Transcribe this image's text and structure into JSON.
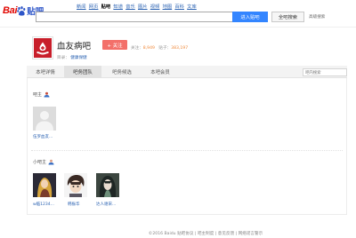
{
  "header": {
    "logo_left": "Bai",
    "logo_right": "贴吧",
    "nav": [
      "新闻",
      "网页",
      "贴吧",
      "知道",
      "音乐",
      "图片",
      "视频",
      "地图",
      "百科",
      "文库"
    ],
    "active_nav": "贴吧",
    "search": {
      "value": "",
      "placeholder": ""
    },
    "enter_button": "进入贴吧",
    "global_search_button": "全吧搜索",
    "advanced_link": "高级搜索"
  },
  "forum": {
    "name": "血友病吧",
    "follow_button": "+ 关注",
    "followers_label": "关注：",
    "followers": "8,949",
    "posts_label": "贴子：",
    "posts": "383,197",
    "category_label": "目录：",
    "category": "健康保健",
    "icon": "hand-drop-icon"
  },
  "tabs": [
    {
      "label": "本吧详情",
      "active": false
    },
    {
      "label": "吧务团队",
      "active": true
    },
    {
      "label": "吧务候选",
      "active": false
    },
    {
      "label": "本吧会员",
      "active": false
    }
  ],
  "inner_search": {
    "placeholder": "吧内搜索"
  },
  "sections": [
    {
      "title": "吧主",
      "icon": "user-icon",
      "members": [
        {
          "name": "伍罗血友...",
          "avatar": "default-avatar"
        }
      ]
    },
    {
      "title": "小吧主",
      "icon": "user-icon",
      "members": [
        {
          "name": "w临1234...",
          "avatar": "anime-avatar"
        },
        {
          "name": "韩振华",
          "avatar": "anime-avatar"
        },
        {
          "name": "达人谢宋...",
          "avatar": "anime-avatar"
        }
      ]
    }
  ],
  "footer": {
    "copyright": "©2016 Baidu",
    "links": [
      "贴吧协议",
      "吧主制度",
      "意见反馈",
      "网络谣言警示"
    ]
  },
  "colors": {
    "brand_red": "#e10601",
    "brand_blue": "#2d55c8",
    "link": "#2d64b3",
    "follow_button": "#f3706a",
    "enter_button": "#3385ff",
    "stat_number": "#f08a3c",
    "forum_icon_bg": "#c81e2a"
  }
}
